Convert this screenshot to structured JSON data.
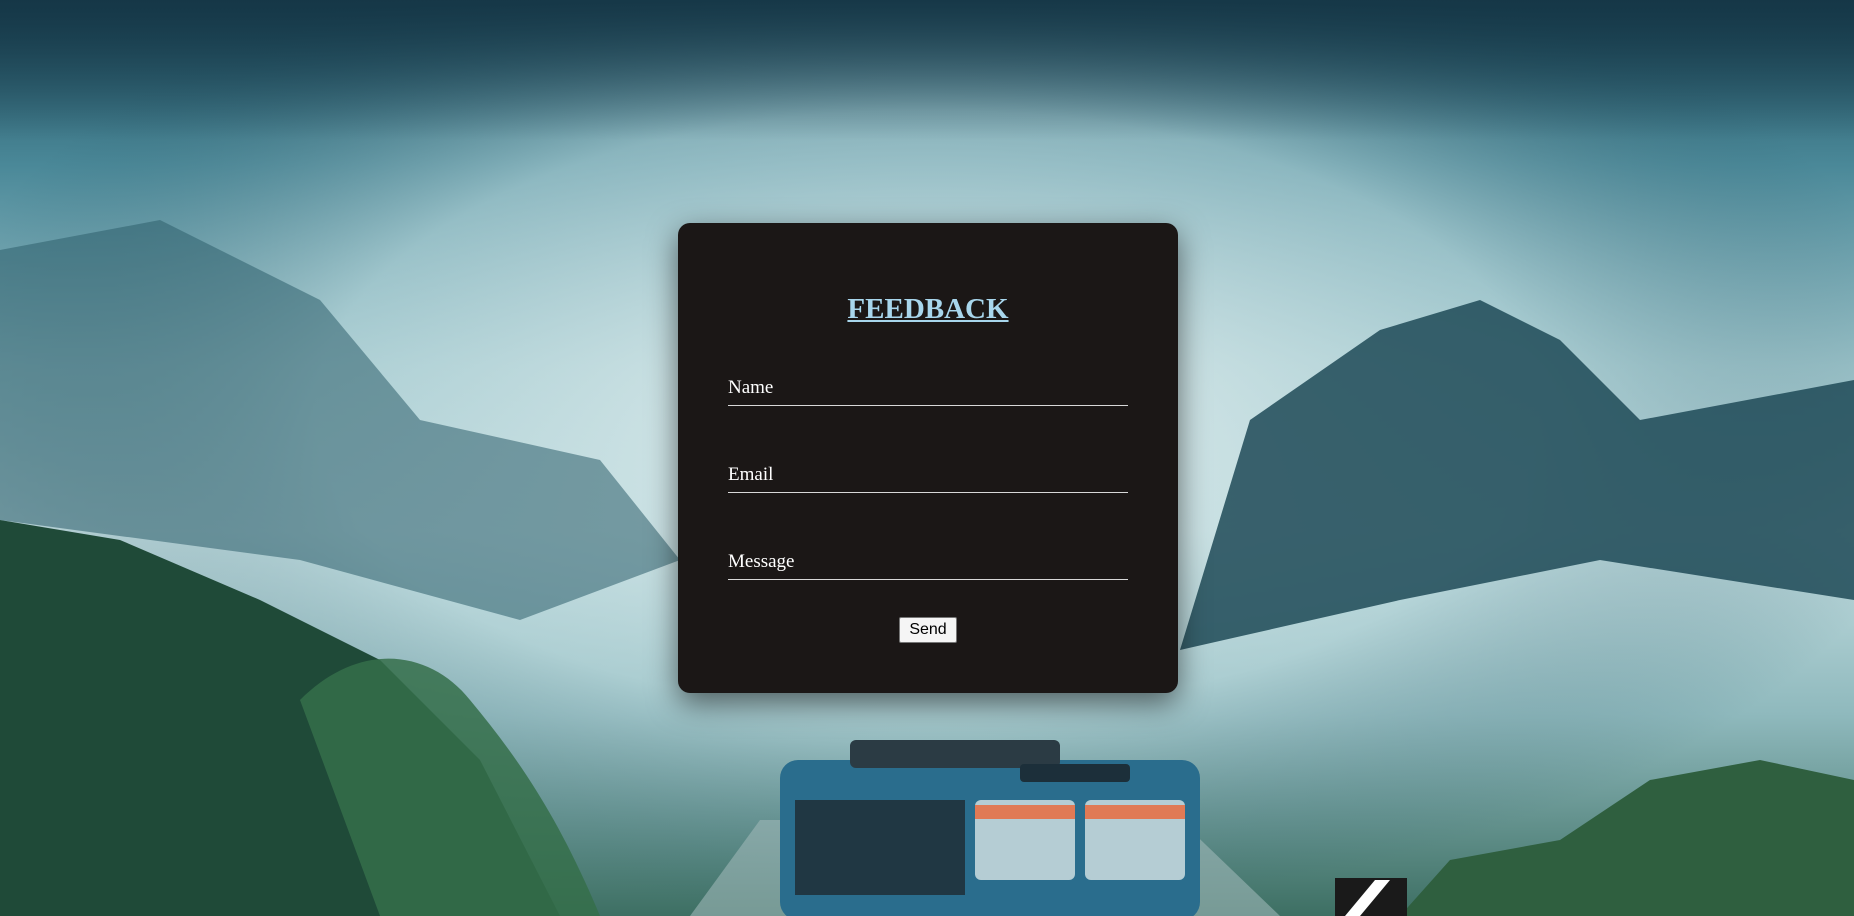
{
  "form": {
    "title": "FEEDBACK",
    "fields": [
      {
        "label": "Name"
      },
      {
        "label": "Email"
      },
      {
        "label": "Message"
      }
    ],
    "submit_label": "Send"
  },
  "colors": {
    "card_background": "#1b1716",
    "title": "#a8d6ec",
    "label": "#ffffff",
    "underline": "#d8d8d8"
  }
}
